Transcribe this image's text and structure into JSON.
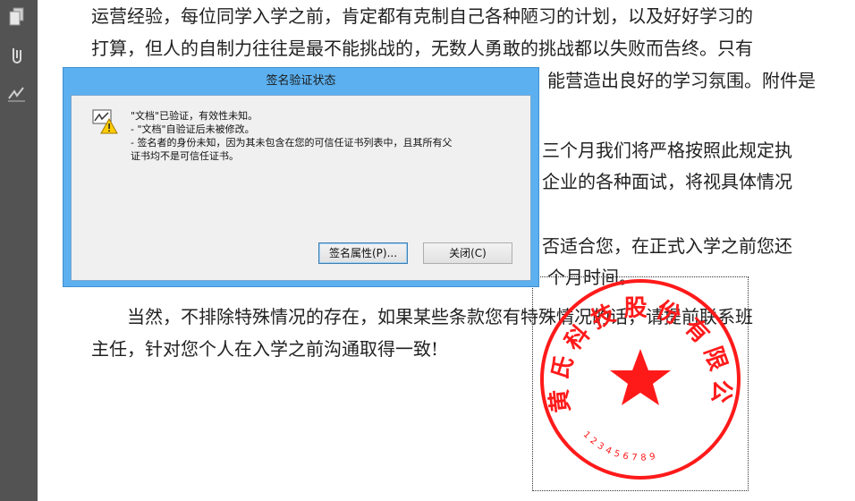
{
  "sidebar": {
    "items": [
      {
        "icon": "pages-icon"
      },
      {
        "icon": "attachment-icon"
      },
      {
        "icon": "signature-icon"
      }
    ]
  },
  "document": {
    "lines": [
      "运营经验，每位同学入学之前，肯定都有克制自己各种陋习的计划，以及好好学习的",
      "打算，但人的自制力往往是最不能挑战的，无数人勇敢的挑战都以失败而告终。只有",
      "能营造出良好的学习氛围。附件是",
      "三个月我们将严格按照此规定执",
      "企业的各种面试，将视具体情况",
      "否适合您，在正式入学之前您还",
      "个月时间。",
      "当然，不排除特殊情况的存在，如果某些条款您有特殊情况的话，请提前联系班",
      "主任，针对您个人在入学之前沟通取得一致!"
    ]
  },
  "dialog": {
    "title": "签名验证状态",
    "messages": [
      "\"文档\"已验证，有效性未知。",
      "- \"文档\"自验证后未被修改。",
      "- 签名者的身份未知，因为其未包含在您的可信任证书列表中，且其所有父",
      "证书均不是可信任证书。"
    ],
    "properties_button": "签名属性(P)...",
    "close_button": "关闭(C)"
  },
  "stamp": {
    "text": "黄氏科技股份有限公司",
    "code": "123456789"
  },
  "colors": {
    "sidebar": "#535353",
    "dialog_frame": "#5cb0ef",
    "stamp_red": "#ff1a1a"
  }
}
